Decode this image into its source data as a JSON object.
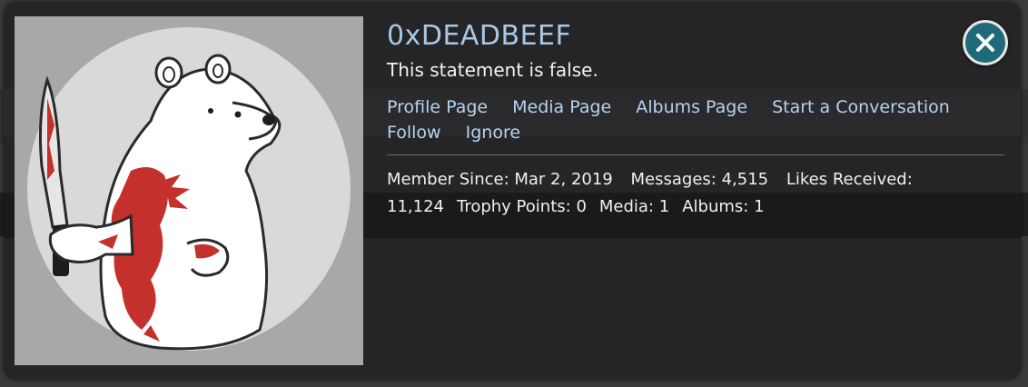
{
  "profile": {
    "username": "0xDEADBEEF",
    "status_message": "This statement is false.",
    "avatar_icon": "bloody-polar-bear-with-knife-avatar"
  },
  "links": [
    {
      "label": "Profile Page"
    },
    {
      "label": "Media Page"
    },
    {
      "label": "Albums Page"
    },
    {
      "label": "Start a Conversation"
    },
    {
      "label": "Follow"
    },
    {
      "label": "Ignore"
    }
  ],
  "stats": [
    {
      "label": "Member Since:",
      "value": "Mar 2, 2019"
    },
    {
      "label": "Messages:",
      "value": "4,515"
    },
    {
      "label": "Likes Received:",
      "value": "11,124"
    },
    {
      "label": "Trophy Points:",
      "value": "0"
    },
    {
      "label": "Media:",
      "value": "1"
    },
    {
      "label": "Albums:",
      "value": "1"
    }
  ],
  "close_button": {
    "icon": "close-icon"
  },
  "colors": {
    "card_background": "#252527",
    "username": "#a9c8e6",
    "link": "#b5d3f0",
    "close_button": "#1f6a7a"
  }
}
